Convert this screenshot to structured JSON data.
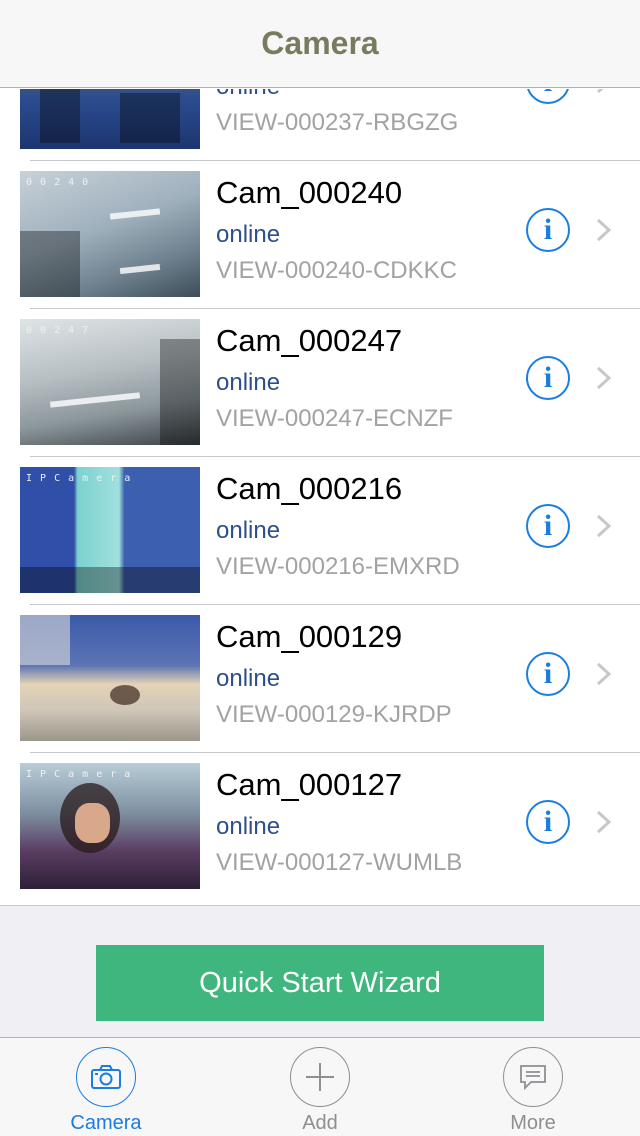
{
  "navbar": {
    "title": "Camera"
  },
  "cameras": [
    {
      "name": "",
      "status": "online",
      "uid": "VIEW-000237-RBGZG",
      "osd": ""
    },
    {
      "name": "Cam_000240",
      "status": "online",
      "uid": "VIEW-000240-CDKKC",
      "osd": "0 0 2 4 0"
    },
    {
      "name": "Cam_000247",
      "status": "online",
      "uid": "VIEW-000247-ECNZF",
      "osd": "0 0 2 4 7"
    },
    {
      "name": "Cam_000216",
      "status": "online",
      "uid": "VIEW-000216-EMXRD",
      "osd": "I P C a m e r a"
    },
    {
      "name": "Cam_000129",
      "status": "online",
      "uid": "VIEW-000129-KJRDP",
      "osd": ""
    },
    {
      "name": "Cam_000127",
      "status": "online",
      "uid": "VIEW-000127-WUMLB",
      "osd": "I P C a m e r a"
    }
  ],
  "icons": {
    "info": "info-icon",
    "chevron": "chevron-right-icon"
  },
  "wizard": {
    "label": "Quick Start Wizard",
    "color": "#3eb67d"
  },
  "tabs": [
    {
      "label": "Camera",
      "icon": "camera-icon",
      "active": true
    },
    {
      "label": "Add",
      "icon": "plus-icon",
      "active": false
    },
    {
      "label": "More",
      "icon": "chat-bubble-icon",
      "active": false
    }
  ],
  "colors": {
    "accent": "#1a7de0",
    "status": "#2e4f8a",
    "title": "#7a7a5e"
  }
}
